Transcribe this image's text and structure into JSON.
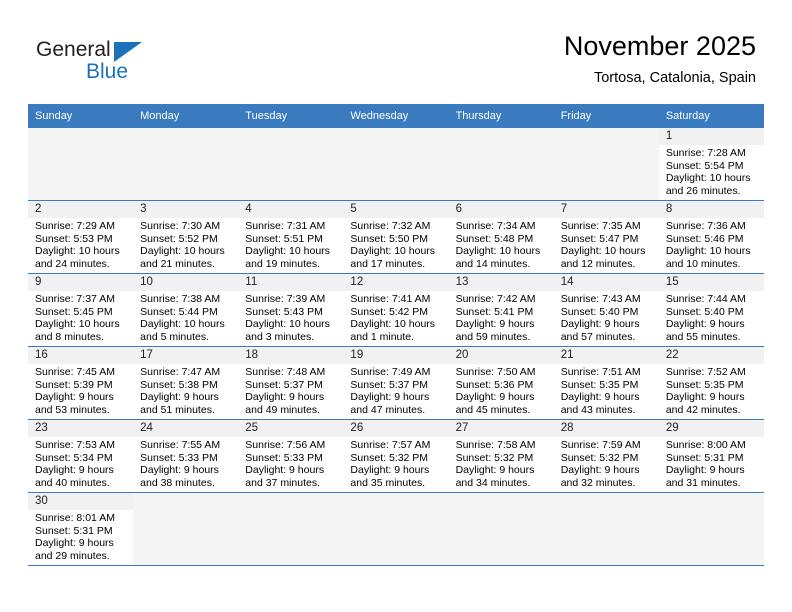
{
  "brand": {
    "name_top": "General",
    "name_bottom": "Blue",
    "accent_color": "#1c72b8"
  },
  "header": {
    "title": "November 2025",
    "location": "Tortosa, Catalonia, Spain"
  },
  "theme": {
    "header_row_bg": "#3a7bbf",
    "daynum_bg": "#f1f1f1",
    "blank_cell_bg": "#f4f4f4"
  },
  "weekdays": [
    "Sunday",
    "Monday",
    "Tuesday",
    "Wednesday",
    "Thursday",
    "Friday",
    "Saturday"
  ],
  "weeks": [
    [
      null,
      null,
      null,
      null,
      null,
      null,
      {
        "day": "1",
        "sunrise": "Sunrise: 7:28 AM",
        "sunset": "Sunset: 5:54 PM",
        "daylight1": "Daylight: 10 hours",
        "daylight2": "and 26 minutes."
      }
    ],
    [
      {
        "day": "2",
        "sunrise": "Sunrise: 7:29 AM",
        "sunset": "Sunset: 5:53 PM",
        "daylight1": "Daylight: 10 hours",
        "daylight2": "and 24 minutes."
      },
      {
        "day": "3",
        "sunrise": "Sunrise: 7:30 AM",
        "sunset": "Sunset: 5:52 PM",
        "daylight1": "Daylight: 10 hours",
        "daylight2": "and 21 minutes."
      },
      {
        "day": "4",
        "sunrise": "Sunrise: 7:31 AM",
        "sunset": "Sunset: 5:51 PM",
        "daylight1": "Daylight: 10 hours",
        "daylight2": "and 19 minutes."
      },
      {
        "day": "5",
        "sunrise": "Sunrise: 7:32 AM",
        "sunset": "Sunset: 5:50 PM",
        "daylight1": "Daylight: 10 hours",
        "daylight2": "and 17 minutes."
      },
      {
        "day": "6",
        "sunrise": "Sunrise: 7:34 AM",
        "sunset": "Sunset: 5:48 PM",
        "daylight1": "Daylight: 10 hours",
        "daylight2": "and 14 minutes."
      },
      {
        "day": "7",
        "sunrise": "Sunrise: 7:35 AM",
        "sunset": "Sunset: 5:47 PM",
        "daylight1": "Daylight: 10 hours",
        "daylight2": "and 12 minutes."
      },
      {
        "day": "8",
        "sunrise": "Sunrise: 7:36 AM",
        "sunset": "Sunset: 5:46 PM",
        "daylight1": "Daylight: 10 hours",
        "daylight2": "and 10 minutes."
      }
    ],
    [
      {
        "day": "9",
        "sunrise": "Sunrise: 7:37 AM",
        "sunset": "Sunset: 5:45 PM",
        "daylight1": "Daylight: 10 hours",
        "daylight2": "and 8 minutes."
      },
      {
        "day": "10",
        "sunrise": "Sunrise: 7:38 AM",
        "sunset": "Sunset: 5:44 PM",
        "daylight1": "Daylight: 10 hours",
        "daylight2": "and 5 minutes."
      },
      {
        "day": "11",
        "sunrise": "Sunrise: 7:39 AM",
        "sunset": "Sunset: 5:43 PM",
        "daylight1": "Daylight: 10 hours",
        "daylight2": "and 3 minutes."
      },
      {
        "day": "12",
        "sunrise": "Sunrise: 7:41 AM",
        "sunset": "Sunset: 5:42 PM",
        "daylight1": "Daylight: 10 hours",
        "daylight2": "and 1 minute."
      },
      {
        "day": "13",
        "sunrise": "Sunrise: 7:42 AM",
        "sunset": "Sunset: 5:41 PM",
        "daylight1": "Daylight: 9 hours",
        "daylight2": "and 59 minutes."
      },
      {
        "day": "14",
        "sunrise": "Sunrise: 7:43 AM",
        "sunset": "Sunset: 5:40 PM",
        "daylight1": "Daylight: 9 hours",
        "daylight2": "and 57 minutes."
      },
      {
        "day": "15",
        "sunrise": "Sunrise: 7:44 AM",
        "sunset": "Sunset: 5:40 PM",
        "daylight1": "Daylight: 9 hours",
        "daylight2": "and 55 minutes."
      }
    ],
    [
      {
        "day": "16",
        "sunrise": "Sunrise: 7:45 AM",
        "sunset": "Sunset: 5:39 PM",
        "daylight1": "Daylight: 9 hours",
        "daylight2": "and 53 minutes."
      },
      {
        "day": "17",
        "sunrise": "Sunrise: 7:47 AM",
        "sunset": "Sunset: 5:38 PM",
        "daylight1": "Daylight: 9 hours",
        "daylight2": "and 51 minutes."
      },
      {
        "day": "18",
        "sunrise": "Sunrise: 7:48 AM",
        "sunset": "Sunset: 5:37 PM",
        "daylight1": "Daylight: 9 hours",
        "daylight2": "and 49 minutes."
      },
      {
        "day": "19",
        "sunrise": "Sunrise: 7:49 AM",
        "sunset": "Sunset: 5:37 PM",
        "daylight1": "Daylight: 9 hours",
        "daylight2": "and 47 minutes."
      },
      {
        "day": "20",
        "sunrise": "Sunrise: 7:50 AM",
        "sunset": "Sunset: 5:36 PM",
        "daylight1": "Daylight: 9 hours",
        "daylight2": "and 45 minutes."
      },
      {
        "day": "21",
        "sunrise": "Sunrise: 7:51 AM",
        "sunset": "Sunset: 5:35 PM",
        "daylight1": "Daylight: 9 hours",
        "daylight2": "and 43 minutes."
      },
      {
        "day": "22",
        "sunrise": "Sunrise: 7:52 AM",
        "sunset": "Sunset: 5:35 PM",
        "daylight1": "Daylight: 9 hours",
        "daylight2": "and 42 minutes."
      }
    ],
    [
      {
        "day": "23",
        "sunrise": "Sunrise: 7:53 AM",
        "sunset": "Sunset: 5:34 PM",
        "daylight1": "Daylight: 9 hours",
        "daylight2": "and 40 minutes."
      },
      {
        "day": "24",
        "sunrise": "Sunrise: 7:55 AM",
        "sunset": "Sunset: 5:33 PM",
        "daylight1": "Daylight: 9 hours",
        "daylight2": "and 38 minutes."
      },
      {
        "day": "25",
        "sunrise": "Sunrise: 7:56 AM",
        "sunset": "Sunset: 5:33 PM",
        "daylight1": "Daylight: 9 hours",
        "daylight2": "and 37 minutes."
      },
      {
        "day": "26",
        "sunrise": "Sunrise: 7:57 AM",
        "sunset": "Sunset: 5:32 PM",
        "daylight1": "Daylight: 9 hours",
        "daylight2": "and 35 minutes."
      },
      {
        "day": "27",
        "sunrise": "Sunrise: 7:58 AM",
        "sunset": "Sunset: 5:32 PM",
        "daylight1": "Daylight: 9 hours",
        "daylight2": "and 34 minutes."
      },
      {
        "day": "28",
        "sunrise": "Sunrise: 7:59 AM",
        "sunset": "Sunset: 5:32 PM",
        "daylight1": "Daylight: 9 hours",
        "daylight2": "and 32 minutes."
      },
      {
        "day": "29",
        "sunrise": "Sunrise: 8:00 AM",
        "sunset": "Sunset: 5:31 PM",
        "daylight1": "Daylight: 9 hours",
        "daylight2": "and 31 minutes."
      }
    ],
    [
      {
        "day": "30",
        "sunrise": "Sunrise: 8:01 AM",
        "sunset": "Sunset: 5:31 PM",
        "daylight1": "Daylight: 9 hours",
        "daylight2": "and 29 minutes."
      },
      null,
      null,
      null,
      null,
      null,
      null
    ]
  ]
}
